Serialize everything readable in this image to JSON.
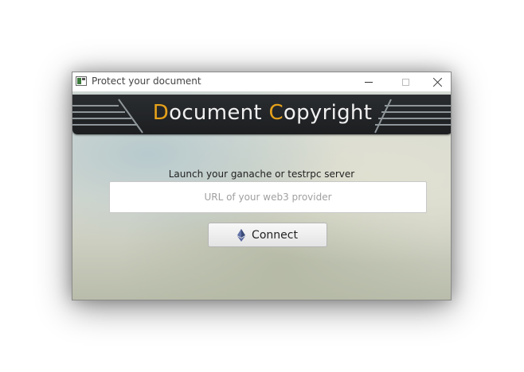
{
  "window": {
    "title": "Protect your document"
  },
  "banner": {
    "title_d": "D",
    "title_rest1": "ocument ",
    "title_c": "C",
    "title_rest2": "opyright",
    "accent_color": "#e6a11a"
  },
  "form": {
    "launch_label": "Launch your ganache or testrpc server",
    "url_placeholder": "URL of your web3 provider",
    "url_value": "",
    "connect_label": "Connect",
    "connect_icon": "ethereum-icon"
  }
}
